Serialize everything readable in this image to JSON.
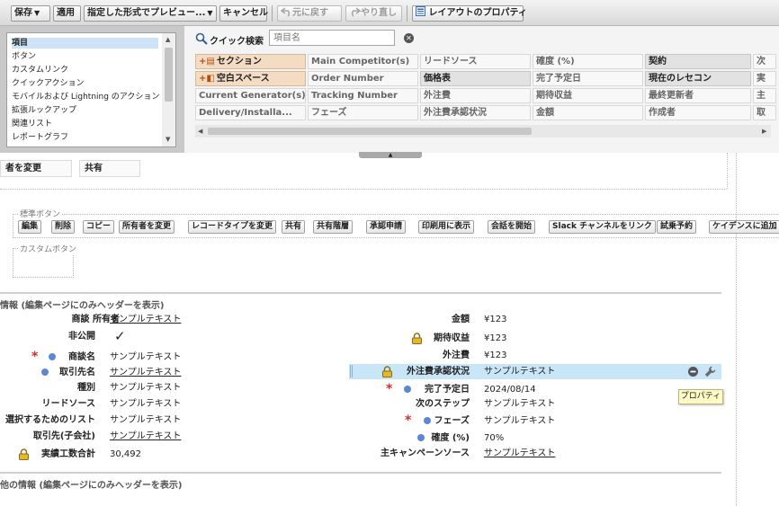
{
  "toolbar": {
    "save": "保存",
    "apply": "適用",
    "preview": "指定した形式でプレビュー...",
    "cancel": "キャンセル",
    "undo": "元に戻す",
    "redo": "やり直し",
    "layout_properties": "レイアウトのプロパティ"
  },
  "palette": {
    "categories": [
      {
        "label": "項目",
        "selected": true
      },
      {
        "label": "ボタン"
      },
      {
        "label": "カスタムリンク"
      },
      {
        "label": "クイックアクション"
      },
      {
        "label": "モバイルおよび Lightning のアクション"
      },
      {
        "label": "拡張ルックアップ"
      },
      {
        "label": "関連リスト"
      },
      {
        "label": "レポートグラフ"
      }
    ],
    "quick_search_label": "クイック検索",
    "quick_search_placeholder": "項目名",
    "clear_symbol": "✕",
    "fields": [
      [
        "セクション",
        "Main Competitor(s)",
        "リードソース",
        "確度 (%)",
        "契約",
        "次"
      ],
      [
        "空白スペース",
        "Order Number",
        "価格表",
        "完了予定日",
        "現在のレセコン",
        "実"
      ],
      [
        "Current Generator(s)",
        "Tracking Number",
        "外注費",
        "期待収益",
        "最終更新者",
        "主"
      ],
      [
        "Delivery/Installa...",
        "フェーズ",
        "外注費承認状況",
        "金額",
        "作成者",
        "取"
      ]
    ]
  },
  "header_buttons": [
    "者を変更",
    "共有"
  ],
  "standard_buttons": {
    "legend": "標準ボタン",
    "items": [
      "編集",
      "削除",
      "コピー",
      "所有者を変更",
      "レコードタイプを変更",
      "共有",
      "共有階層",
      "承認申請",
      "印刷用に表示",
      "会話を開始",
      "Slack チャンネルをリンク",
      "試乗予約",
      "ケイデンスに追加"
    ]
  },
  "custom_buttons": {
    "legend": "カスタムボタン"
  },
  "section1": {
    "title": "情報 (編集ページにのみヘッダーを表示)",
    "left": [
      {
        "label": "商談 所有者",
        "value": "サンプルテキスト",
        "link": true
      },
      {
        "label": "非公開",
        "value": "✓"
      },
      {
        "label": "商談名",
        "value": "サンプルテキスト",
        "required": true,
        "dot": true
      },
      {
        "label": "取引先名",
        "value": "サンプルテキスト",
        "link": true,
        "dot": true
      },
      {
        "label": "種別",
        "value": "サンプルテキスト"
      },
      {
        "label": "リードソース",
        "value": "サンプルテキスト"
      },
      {
        "label": "選択するためのリスト",
        "value": "サンプルテキスト"
      },
      {
        "label": "取引先(子会社)",
        "value": "サンプルテキスト",
        "link": true
      },
      {
        "label": "実績工数合計",
        "value": "30,492",
        "lock": true
      }
    ],
    "right": [
      {
        "label": "金額",
        "value": "¥123"
      },
      {
        "label": "期待収益",
        "value": "¥123",
        "lock": true
      },
      {
        "label": "外注費",
        "value": "¥123"
      },
      {
        "label": "外注費承認状況",
        "value": "サンプルテキスト",
        "lock": true,
        "highlight": true
      },
      {
        "label": "完了予定日",
        "value": "2024/08/14",
        "required": true,
        "dot": true
      },
      {
        "label": "次のステップ",
        "value": "サンプルテキスト"
      },
      {
        "label": "フェーズ",
        "value": "サンプルテキスト",
        "required": true,
        "dot": true
      },
      {
        "label": "確度 (%)",
        "value": "70%",
        "dot": true
      },
      {
        "label": "主キャンペーンソース",
        "value": "サンプルテキスト",
        "link": true
      }
    ],
    "required_symbol": "*",
    "tooltip": "プロパティ"
  },
  "section2": {
    "title": "他の情報 (編集ページにのみヘッダーを表示)"
  },
  "colors": {
    "highlight": "#c8e6f7",
    "required": "#d22a2a",
    "dot": "#5a87d6",
    "palette_special": "#f4dcc4"
  }
}
